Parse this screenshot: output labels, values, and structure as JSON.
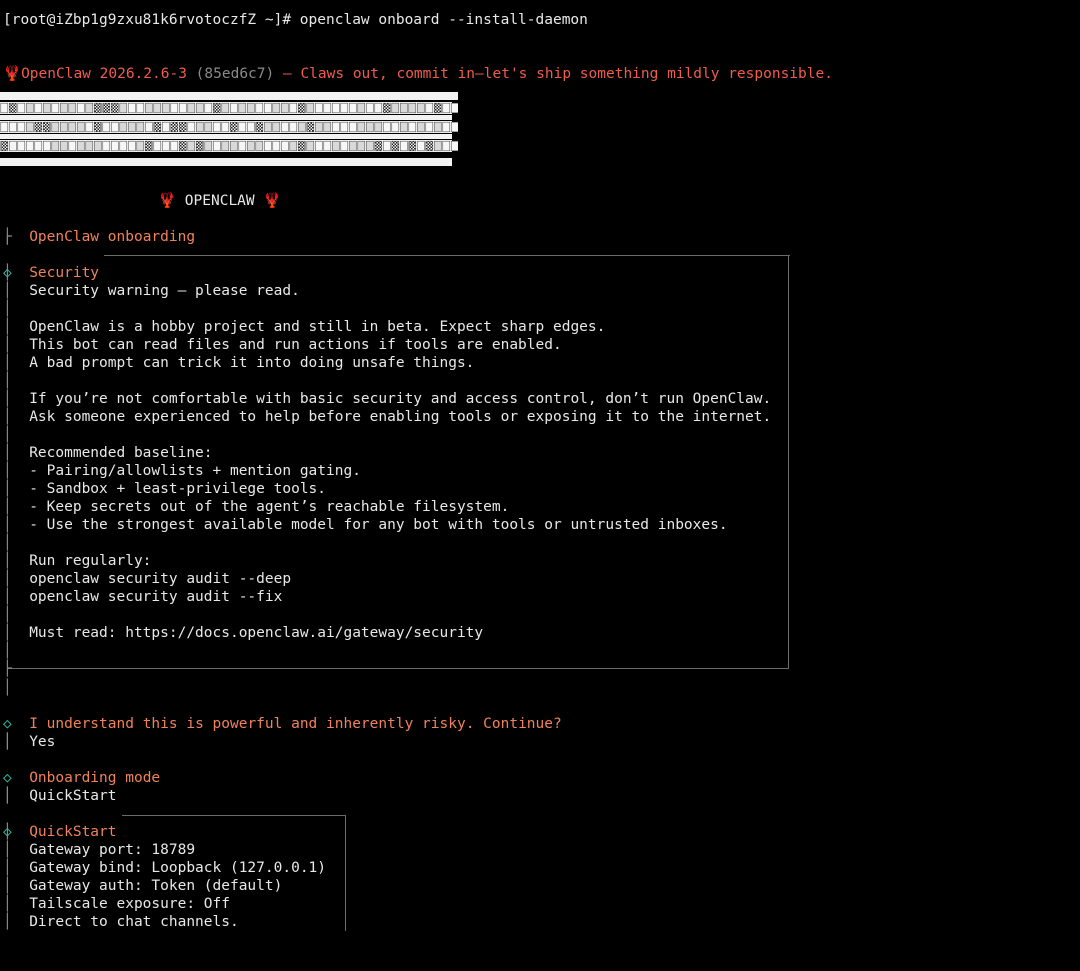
{
  "terminal": {
    "prompt_line": "[root@iZbp1g9zxu81k6rvotoczfZ ~]# openclaw onboard --install-daemon",
    "version_lobster": "🦞",
    "version_name": "OpenClaw 2026.2.6-3",
    "version_hash": "(85ed6c7)",
    "tagline": "– Claws out, commit in—let's ship something mildly responsible.",
    "banner_title": "OPENCLAW",
    "banner_lobster": "🦞"
  },
  "onboarding": {
    "header": "OpenClaw onboarding",
    "security": {
      "title": "Security",
      "lines": [
        "Security warning — please read.",
        "",
        "OpenClaw is a hobby project and still in beta. Expect sharp edges.",
        "This bot can read files and run actions if tools are enabled.",
        "A bad prompt can trick it into doing unsafe things.",
        "",
        "If you’re not comfortable with basic security and access control, don’t run OpenClaw.",
        "Ask someone experienced to help before enabling tools or exposing it to the internet.",
        "",
        "Recommended baseline:",
        "- Pairing/allowlists + mention gating.",
        "- Sandbox + least-privilege tools.",
        "- Keep secrets out of the agent’s reachable filesystem.",
        "- Use the strongest available model for any bot with tools or untrusted inboxes.",
        "",
        "Run regularly:",
        "openclaw security audit --deep",
        "openclaw security audit --fix",
        "",
        "Must read: https://docs.openclaw.ai/gateway/security"
      ]
    },
    "confirm": {
      "question": "I understand this is powerful and inherently risky. Continue?",
      "answer": "Yes"
    },
    "mode": {
      "question": "Onboarding mode",
      "answer": "QuickStart"
    },
    "quickstart": {
      "title": "QuickStart",
      "lines": [
        "Gateway port: 18789",
        "Gateway bind: Loopback (127.0.0.1)",
        "Gateway auth: Token (default)",
        "Tailscale exposure: Off",
        "Direct to chat channels."
      ]
    }
  },
  "colors": {
    "background": "#000000",
    "accent_orange": "#f0825a",
    "accent_red": "#ef5d4a",
    "diamond_teal": "#35b5a0",
    "text": "#e6e6e6"
  }
}
